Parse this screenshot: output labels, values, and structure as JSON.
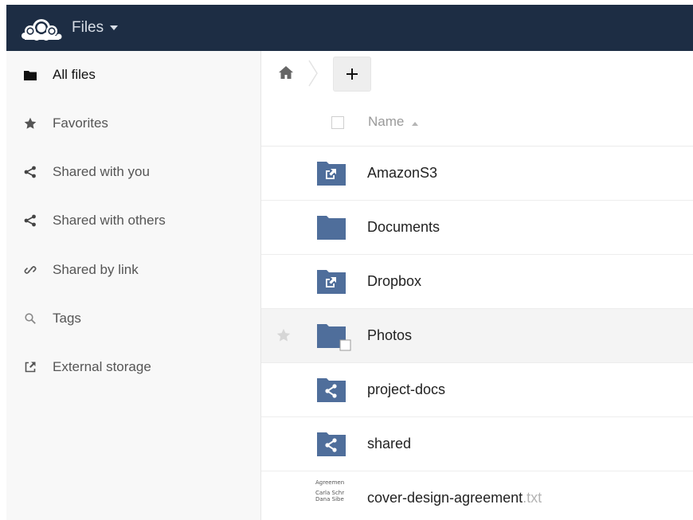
{
  "header": {
    "app_name": "Files",
    "logo_icon": "cloud-logo-icon",
    "background": "#1d2d44"
  },
  "sidebar": {
    "items": [
      {
        "label": "All files",
        "icon": "folder-icon",
        "active": true
      },
      {
        "label": "Favorites",
        "icon": "star-icon",
        "active": false
      },
      {
        "label": "Shared with you",
        "icon": "share-icon",
        "active": false
      },
      {
        "label": "Shared with others",
        "icon": "share-icon",
        "active": false
      },
      {
        "label": "Shared by link",
        "icon": "link-icon",
        "active": false
      },
      {
        "label": "Tags",
        "icon": "search-icon",
        "active": false
      },
      {
        "label": "External storage",
        "icon": "external-icon",
        "active": false
      }
    ]
  },
  "controls": {
    "home_icon": "home-icon",
    "new_label": "+"
  },
  "file_list": {
    "sort_label": "Name",
    "sort_icon": "sort-ascending-icon",
    "rows": [
      {
        "name": "AmazonS3",
        "ext": "",
        "icon": "external-folder-icon"
      },
      {
        "name": "Documents",
        "ext": "",
        "icon": "folder-icon"
      },
      {
        "name": "Dropbox",
        "ext": "",
        "icon": "external-folder-icon"
      },
      {
        "name": "Photos",
        "ext": "",
        "icon": "folder-icon"
      },
      {
        "name": "project-docs",
        "ext": "",
        "icon": "shared-folder-icon"
      },
      {
        "name": "shared",
        "ext": "",
        "icon": "shared-folder-icon"
      },
      {
        "name": "cover-design-agreement",
        "ext": ".txt",
        "icon": "text-file-thumbnail",
        "thumbnail_text": [
          "Agreemen",
          "Carla Schr",
          "Dana Sibe"
        ]
      }
    ]
  },
  "colors": {
    "folder": "#4f6e9b",
    "sidebar_bg": "#f8f8f8",
    "accent": "#1d2d44"
  }
}
